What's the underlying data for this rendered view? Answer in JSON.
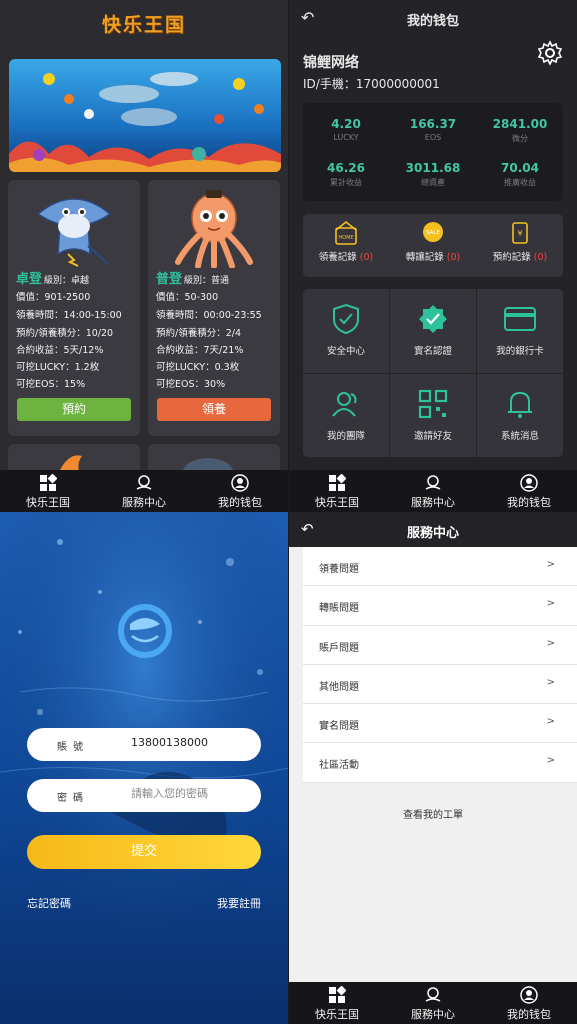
{
  "kingdom": {
    "title": "快乐王国",
    "cards": [
      {
        "name": "卓登",
        "level": "級別：卓越",
        "lines": [
          "價值：901-2500",
          "領養時間：14:00-15:00",
          "預約/領養積分：10/20",
          "合約收益：5天/12%",
          "可挖LUCKY：1.2枚",
          "可挖EOS：15%"
        ],
        "button": "預約",
        "button_color": "#6db33f"
      },
      {
        "name": "普登",
        "level": "級別：普通",
        "lines": [
          "價值：50-300",
          "領養時間：00:00-23:55",
          "預約/領養積分：2/4",
          "合約收益：7天/21%",
          "可挖LUCKY：0.3枚",
          "可挖EOS：30%"
        ],
        "button": "領養",
        "button_color": "#e8683e"
      }
    ],
    "accent": "#2dc29b"
  },
  "tabs": [
    "快乐王国",
    "服務中心",
    "我的钱包"
  ],
  "wallet": {
    "title": "我的钱包",
    "name": "锦鲤网络",
    "id_line": "ID/手機：17000000001",
    "stats": [
      {
        "value": "4.20",
        "label": "LUCKY"
      },
      {
        "value": "166.37",
        "label": "EOS"
      },
      {
        "value": "2841.00",
        "label": "微分"
      },
      {
        "value": "46.26",
        "label": "累計收益"
      },
      {
        "value": "3011.68",
        "label": "總資產"
      },
      {
        "value": "70.04",
        "label": "推廣收益"
      }
    ],
    "records": [
      {
        "label": "領養記錄",
        "count": "(0)"
      },
      {
        "label": "轉讓記錄",
        "count": "(0)"
      },
      {
        "label": "預約記錄",
        "count": "(0)"
      }
    ],
    "grid": [
      "安全中心",
      "實名認證",
      "我的銀行卡",
      "我的團隊",
      "邀請好友",
      "系統消息"
    ]
  },
  "login": {
    "account_label": "賬號",
    "account_value": "13800138000",
    "password_label": "密碼",
    "password_placeholder": "請輸入您的密碼",
    "submit": "提交",
    "forgot": "忘記密碼",
    "register": "我要註冊"
  },
  "service": {
    "title": "服務中心",
    "items": [
      "領養問題",
      "轉賬問題",
      "賬戶問題",
      "其他問題",
      "實名問題",
      "社區活動"
    ],
    "arrow": ">",
    "tickets": "查看我的工單"
  }
}
